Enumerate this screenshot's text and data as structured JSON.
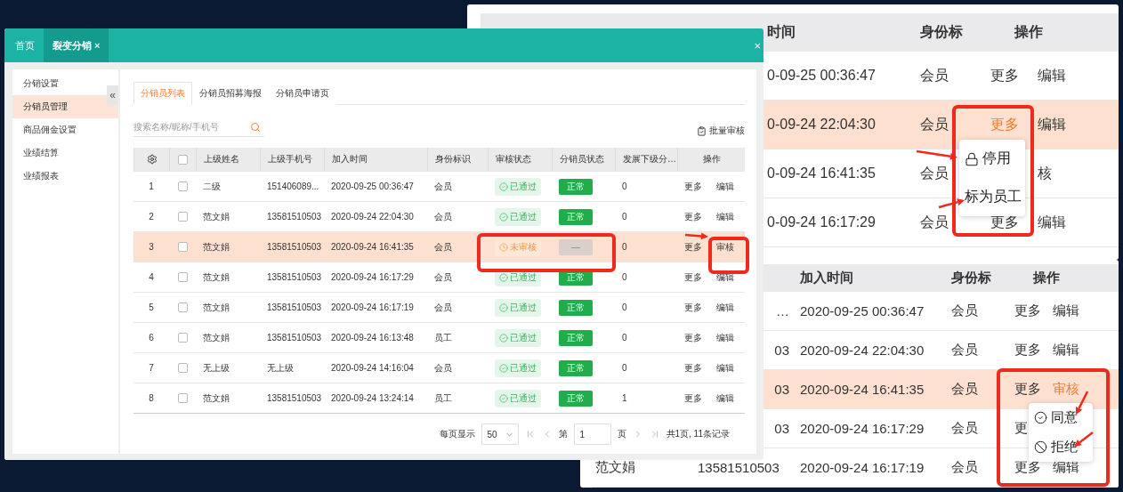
{
  "main_window": {
    "tabs": [
      {
        "label": "首页",
        "selected": false
      },
      {
        "label": "裂变分销",
        "selected": true,
        "close": "×"
      }
    ],
    "close": "×",
    "sidebar": {
      "collapse": "«",
      "items": [
        {
          "label": "分销设置",
          "selected": false
        },
        {
          "label": "分销员管理",
          "selected": true
        },
        {
          "label": "商品佣金设置",
          "selected": false
        },
        {
          "label": "业绩结算",
          "selected": false
        },
        {
          "label": "业绩报表",
          "selected": false
        }
      ]
    },
    "subtabs": [
      {
        "label": "分销员列表",
        "selected": true
      },
      {
        "label": "分销员招募海报",
        "selected": false
      },
      {
        "label": "分销员申请页",
        "selected": false
      }
    ],
    "search": {
      "placeholder": "搜索名称/昵称/手机号"
    },
    "batch_button": "批量审核",
    "table": {
      "select_all": false,
      "columns": [
        "上级姓名",
        "上级手机号",
        "加入时间",
        "身份标识",
        "审核状态",
        "分销员状态",
        "发展下级分…",
        "操作"
      ],
      "rows": [
        {
          "index": "1",
          "checked": false,
          "highlighted": false,
          "name": "二级",
          "phone": "151406089...",
          "time": "2020-09-25 00:36:47",
          "identity": "会员",
          "audit": {
            "kind": "passed",
            "label": "已通过"
          },
          "status": {
            "kind": "normal",
            "label": "正常"
          },
          "count": "0",
          "actions": [
            {
              "kind": "more",
              "label": "更多",
              "highlighted": false
            },
            {
              "kind": "edit",
              "label": "编辑",
              "highlighted": false
            }
          ]
        },
        {
          "index": "2",
          "checked": false,
          "highlighted": false,
          "name": "范文娟",
          "phone": "13581510503",
          "time": "2020-09-24 22:04:30",
          "identity": "会员",
          "audit": {
            "kind": "passed",
            "label": "已通过"
          },
          "status": {
            "kind": "normal",
            "label": "正常"
          },
          "count": "0",
          "actions": [
            {
              "kind": "more",
              "label": "更多",
              "highlighted": false
            },
            {
              "kind": "edit",
              "label": "编辑",
              "highlighted": false
            }
          ]
        },
        {
          "index": "3",
          "checked": false,
          "highlighted": true,
          "name": "范文娟",
          "phone": "13581510503",
          "time": "2020-09-24 16:41:35",
          "identity": "会员",
          "audit": {
            "kind": "pending",
            "label": "未审核"
          },
          "status": {
            "kind": "none",
            "label": "—"
          },
          "count": "0",
          "actions": [
            {
              "kind": "more",
              "label": "更多",
              "highlighted": false
            },
            {
              "kind": "audit",
              "label": "审核",
              "highlighted": false
            }
          ]
        },
        {
          "index": "4",
          "checked": false,
          "highlighted": false,
          "name": "范文娟",
          "phone": "13581510503",
          "time": "2020-09-24 16:17:29",
          "identity": "会员",
          "audit": {
            "kind": "passed",
            "label": "已通过"
          },
          "status": {
            "kind": "normal",
            "label": "正常"
          },
          "count": "0",
          "actions": [
            {
              "kind": "more",
              "label": "更多",
              "highlighted": false
            },
            {
              "kind": "edit",
              "label": "编辑",
              "highlighted": false
            }
          ]
        },
        {
          "index": "5",
          "checked": false,
          "highlighted": false,
          "name": "范文娟",
          "phone": "13581510503",
          "time": "2020-09-24 16:17:19",
          "identity": "会员",
          "audit": {
            "kind": "passed",
            "label": "已通过"
          },
          "status": {
            "kind": "normal",
            "label": "正常"
          },
          "count": "0",
          "actions": [
            {
              "kind": "more",
              "label": "更多",
              "highlighted": false
            },
            {
              "kind": "edit",
              "label": "编辑",
              "highlighted": false
            }
          ]
        },
        {
          "index": "6",
          "checked": false,
          "highlighted": false,
          "name": "范文娟",
          "phone": "13581510503",
          "time": "2020-09-24 16:13:48",
          "identity": "员工",
          "audit": {
            "kind": "passed",
            "label": "已通过"
          },
          "status": {
            "kind": "normal",
            "label": "正常"
          },
          "count": "0",
          "actions": [
            {
              "kind": "more",
              "label": "更多",
              "highlighted": false
            },
            {
              "kind": "edit",
              "label": "编辑",
              "highlighted": false
            }
          ]
        },
        {
          "index": "7",
          "checked": false,
          "highlighted": false,
          "name": "无上级",
          "phone": "无上级",
          "time": "2020-09-24 14:16:04",
          "identity": "会员",
          "audit": {
            "kind": "passed",
            "label": "已通过"
          },
          "status": {
            "kind": "normal",
            "label": "正常"
          },
          "count": "0",
          "actions": [
            {
              "kind": "more",
              "label": "更多",
              "highlighted": false
            },
            {
              "kind": "edit",
              "label": "编辑",
              "highlighted": false
            }
          ]
        },
        {
          "index": "8",
          "checked": false,
          "highlighted": false,
          "name": "范文娟",
          "phone": "13581510503",
          "time": "2020-09-24 13:24:14",
          "identity": "员工",
          "audit": {
            "kind": "passed",
            "label": "已通过"
          },
          "status": {
            "kind": "normal",
            "label": "正常"
          },
          "count": "1",
          "actions": [
            {
              "kind": "more",
              "label": "更多",
              "highlighted": false
            },
            {
              "kind": "edit",
              "label": "编辑",
              "highlighted": false
            }
          ]
        }
      ]
    },
    "pagination": {
      "page_size_label": "每页显示",
      "page_size": "50",
      "page_prefix": "第",
      "page": "1",
      "page_suffix": "页",
      "summary": "共1页, 11条记录"
    }
  },
  "zoom_top": {
    "columns": [
      "时间",
      "身份标",
      "操作"
    ],
    "rows": [
      {
        "time": "0-09-25 00:36:47",
        "identity": "会员",
        "highlighted": false,
        "actions": [
          {
            "kind": "more",
            "label": "更多",
            "highlighted": false
          },
          {
            "kind": "edit",
            "label": "编辑",
            "highlighted": false
          }
        ]
      },
      {
        "time": "0-09-24 22:04:30",
        "identity": "会员",
        "highlighted": true,
        "actions": [
          {
            "kind": "more",
            "label": "更多",
            "highlighted": true
          },
          {
            "kind": "edit",
            "label": "编辑",
            "highlighted": false
          }
        ]
      },
      {
        "time": "0-09-24 16:41:35",
        "identity": "会员",
        "highlighted": false,
        "actions": [
          {
            "kind": "audit",
            "label": "核",
            "highlighted": false
          }
        ]
      },
      {
        "time": "0-09-24 16:17:29",
        "identity": "会员",
        "highlighted": false,
        "actions": [
          {
            "kind": "more",
            "label": "更多",
            "highlighted": false
          },
          {
            "kind": "edit",
            "label": "编辑",
            "highlighted": false
          }
        ]
      }
    ],
    "menu": [
      {
        "kind": "lock",
        "label": "停用"
      },
      {
        "kind": "plain",
        "label": "标为员工"
      }
    ]
  },
  "zoom_bottom": {
    "columns": [
      "加入时间",
      "身份标",
      "操作"
    ],
    "rows": [
      {
        "phone": "…",
        "time": "2020-09-25 00:36:47",
        "identity": "会员",
        "highlighted": false,
        "actions": [
          {
            "kind": "more",
            "label": "更多",
            "highlighted": false
          },
          {
            "kind": "edit",
            "label": "编辑",
            "highlighted": false
          }
        ]
      },
      {
        "phone": "03",
        "time": "2020-09-24 22:04:30",
        "identity": "会员",
        "highlighted": false,
        "actions": [
          {
            "kind": "more",
            "label": "更多",
            "highlighted": false
          },
          {
            "kind": "edit",
            "label": "编辑",
            "highlighted": false
          }
        ]
      },
      {
        "phone": "03",
        "time": "2020-09-24 16:41:35",
        "identity": "会员",
        "highlighted": true,
        "actions": [
          {
            "kind": "more",
            "label": "更多",
            "highlighted": false
          },
          {
            "kind": "audit",
            "label": "审核",
            "highlighted": true
          }
        ]
      },
      {
        "phone": "03",
        "time": "2020-09-24 16:17:29",
        "identity": "会员",
        "highlighted": false,
        "actions": [
          {
            "kind": "more",
            "label": "更",
            "highlighted": false
          }
        ]
      },
      {
        "name": "范文娟",
        "phone": "13581510503",
        "time": "2020-09-24 16:17:19",
        "identity": "会员",
        "highlighted": false,
        "actions": [
          {
            "kind": "more",
            "label": "更多",
            "highlighted": false
          },
          {
            "kind": "edit",
            "label": "编辑",
            "highlighted": false
          }
        ]
      }
    ],
    "menu": [
      {
        "kind": "approve",
        "label": "同意"
      },
      {
        "kind": "reject",
        "label": "拒绝"
      }
    ]
  }
}
